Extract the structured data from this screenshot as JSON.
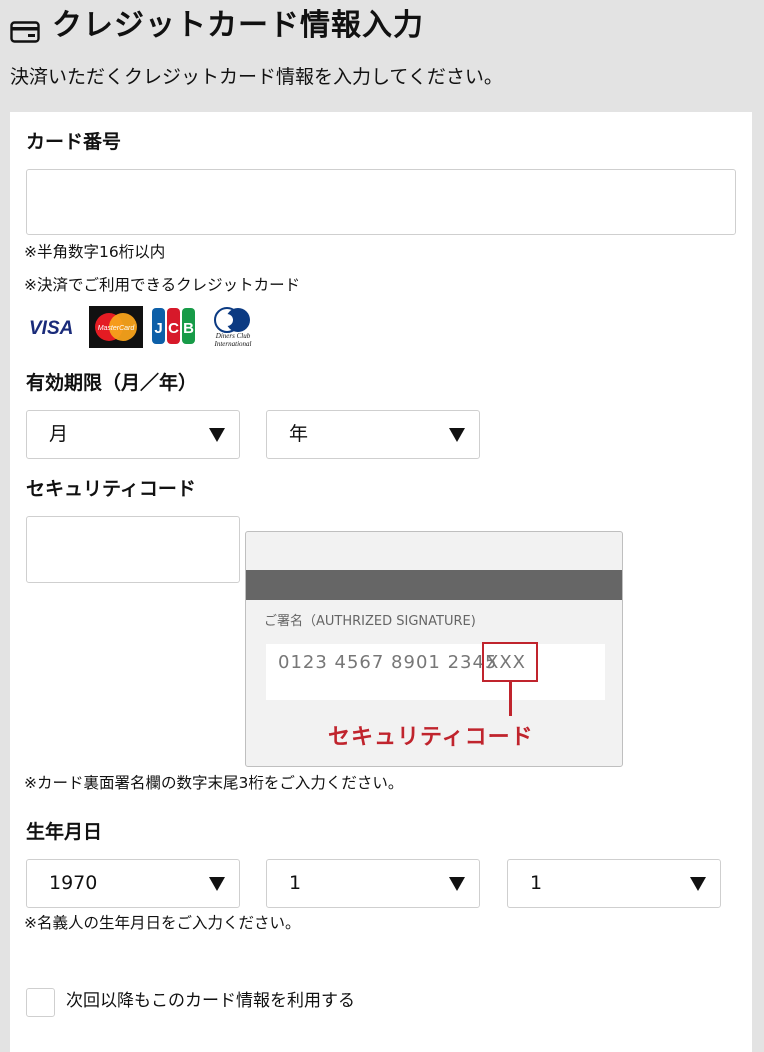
{
  "header": {
    "icon": "credit-card-icon",
    "title": "クレジットカード情報入力",
    "subtitle": "決済いただくクレジットカード情報を入力してください。"
  },
  "card_number": {
    "label": "カード番号",
    "value": "",
    "note_digits": "※半角数字16桁以内",
    "note_brands": "※決済でご利用できるクレジットカード",
    "brands": [
      "VISA",
      "MasterCard",
      "JCB",
      "Diners Club International"
    ]
  },
  "expiry": {
    "label": "有効期限（月／年）",
    "month_value": "月",
    "year_value": "年"
  },
  "security_code": {
    "label": "セキュリティコード",
    "value": "",
    "image": {
      "signature_label": "ご署名（AUTHRIZED SIGNATURE)",
      "card_number": "0123 4567 8901 2345",
      "cvv": "XXX",
      "caption": "セキュリティコード"
    },
    "note": "※カード裏面署名欄の数字末尾3桁をご入力ください。"
  },
  "birthdate": {
    "label": "生年月日",
    "year_value": "1970",
    "month_value": "1",
    "day_value": "1",
    "note": "※名義人の生年月日をご入力ください。"
  },
  "save_card": {
    "checked": false,
    "label": "次回以降もこのカード情報を利用する"
  },
  "colors": {
    "background": "#e3e3e3",
    "panel": "#ffffff",
    "accent_red": "#c0242d",
    "stripe": "#666666"
  }
}
